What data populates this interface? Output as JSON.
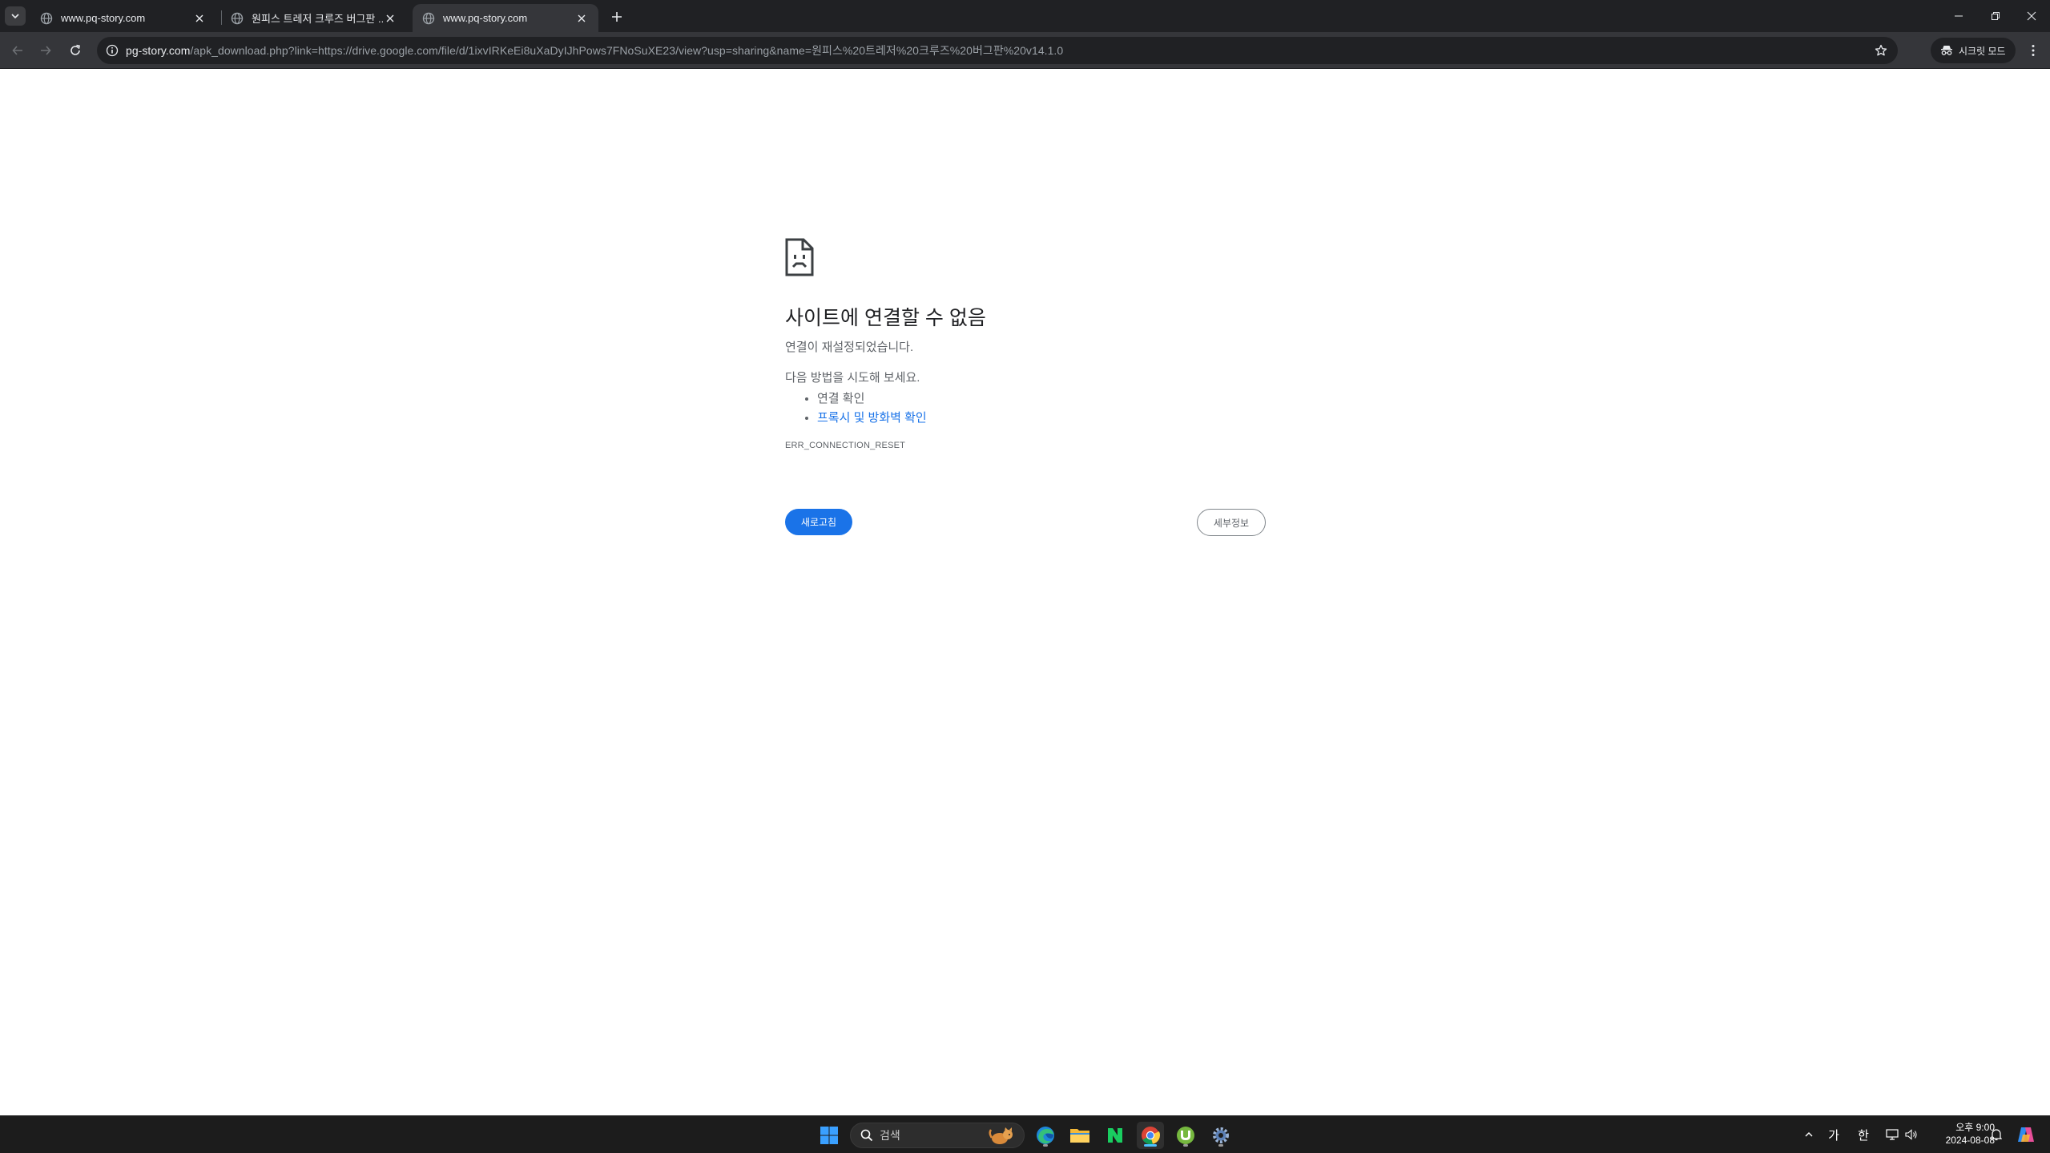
{
  "browser": {
    "tabs": [
      {
        "title": "www.pq-story.com",
        "active": false
      },
      {
        "title": "원피스 트레저 크루즈 버그판 ...",
        "active": false
      },
      {
        "title": "www.pq-story.com",
        "active": true
      }
    ],
    "address": {
      "host": "pg-story.com",
      "path": "/apk_download.php?link=https://drive.google.com/file/d/1ixvIRKeEi8uXaDyIJhPows7FNoSuXE23/view?usp=sharing&name=원피스%20트레저%20크루즈%20버그판%20v14.1.0"
    },
    "incognito_label": "시크릿 모드"
  },
  "error_page": {
    "heading": "사이트에 연결할 수 없음",
    "subtitle": "연결이 재설정되었습니다.",
    "suggestions_intro": "다음 방법을 시도해 보세요.",
    "suggestions": [
      {
        "text": "연결 확인",
        "is_link": false
      },
      {
        "text": "프록시 및 방화벽 확인",
        "is_link": true
      }
    ],
    "error_code": "ERR_CONNECTION_RESET",
    "reload_label": "새로고침",
    "details_label": "세부정보"
  },
  "taskbar": {
    "search_placeholder": "검색",
    "apps": [
      "start-icon",
      "edge-icon",
      "file-explorer-icon",
      "naver-icon",
      "chrome-icon",
      "utorrent-icon",
      "settings-icon"
    ],
    "tray": {
      "ime_mode": "가",
      "ime_lang": "한",
      "time": "오후 9:00",
      "date": "2024-08-08"
    }
  },
  "colors": {
    "chrome_frame": "#202124",
    "chrome_toolbar": "#35363a",
    "accent_blue": "#1a73e8",
    "taskbar": "#1c1c1c"
  }
}
